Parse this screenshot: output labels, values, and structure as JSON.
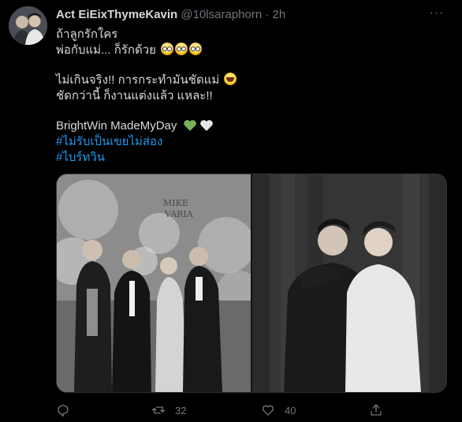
{
  "tweet": {
    "author_name": "Act EiEixThymeKavin",
    "handle": "@10lsaraphorn",
    "dot": "·",
    "time": "2h",
    "more": "···",
    "lines": [
      "ถ้าลูกรักใคร",
      "พ่อกับแม่... ก็รักด้วย",
      "ไม่เกินจริง!!  การกระทำมันชัดแม่",
      "ชัดกว่านี้ ก็งานแต่งแล้ว แหละ!!",
      "BrightWin MadeMyDay"
    ],
    "hashtags": [
      "#ไม่รับเป็นเขยไม่ส่อง",
      "#ไบร์ทวิน"
    ],
    "photo_sign_text": "MIKE\nVARIA",
    "retweet_count": "32",
    "like_count": "40"
  },
  "colors": {
    "background": "#000000",
    "text": "#d9d9d9",
    "secondary": "#6e767d",
    "link": "#1d9bf0",
    "green_heart": "#78b159",
    "white_heart": "#e6e6e6"
  }
}
